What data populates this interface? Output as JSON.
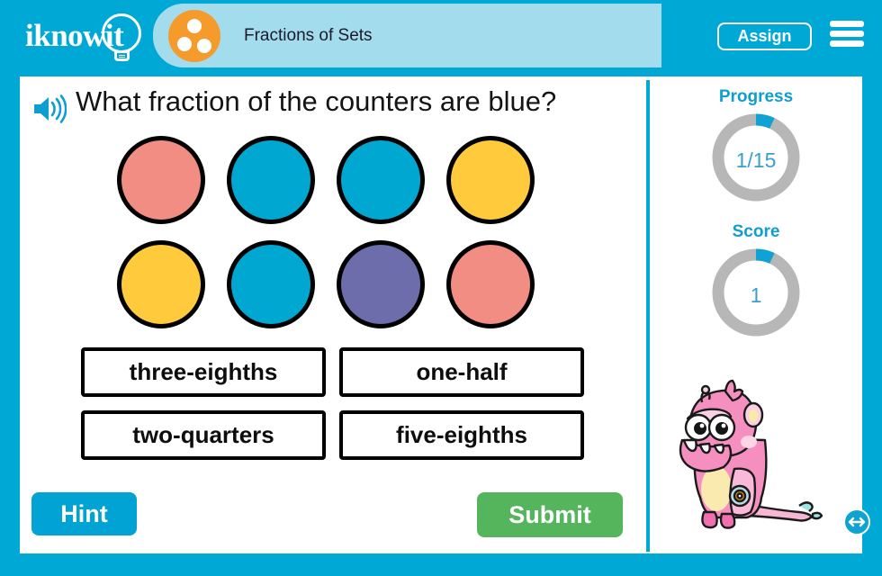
{
  "header": {
    "logo_text": "iknowit",
    "logo_icon": "lightbulb-icon",
    "lesson_icon": "three-dots-circle-icon",
    "lesson_title": "Fractions of Sets",
    "assign_label": "Assign",
    "menu_icon": "hamburger-menu-icon"
  },
  "question": {
    "speaker_icon": "speaker-audio-icon",
    "text": "What fraction of the counters are blue?"
  },
  "counters": {
    "total": 8,
    "items": [
      {
        "index": 1,
        "color_name": "salmon",
        "color": "#F28D84"
      },
      {
        "index": 2,
        "color_name": "blue",
        "color": "#00A8D1"
      },
      {
        "index": 3,
        "color_name": "blue",
        "color": "#00A8D1"
      },
      {
        "index": 4,
        "color_name": "yellow",
        "color": "#FFCB3C"
      },
      {
        "index": 5,
        "color_name": "yellow",
        "color": "#FFCB3C"
      },
      {
        "index": 6,
        "color_name": "blue",
        "color": "#00A8D1"
      },
      {
        "index": 7,
        "color_name": "purple",
        "color": "#6C6DAA"
      },
      {
        "index": 8,
        "color_name": "salmon",
        "color": "#F28D84"
      }
    ]
  },
  "answers": [
    {
      "label": "three-eighths"
    },
    {
      "label": "one-half"
    },
    {
      "label": "two-quarters"
    },
    {
      "label": "five-eighths"
    }
  ],
  "controls": {
    "hint_label": "Hint",
    "submit_label": "Submit"
  },
  "sidebar": {
    "progress": {
      "label": "Progress",
      "value": "1/15",
      "current": 1,
      "total": 15,
      "percent": 7
    },
    "score": {
      "label": "Score",
      "value": "1",
      "percent": 7
    },
    "mascot_icon": "pink-monster-mascot",
    "swap_icon": "left-right-arrow-icon"
  },
  "colors": {
    "brand_blue": "#00A8D6",
    "tab_blue": "#A3DCED",
    "orange": "#F59B2C",
    "green": "#54B55D",
    "meter_track": "#B7B7B7",
    "meter_fill": "#0FA3D4"
  }
}
